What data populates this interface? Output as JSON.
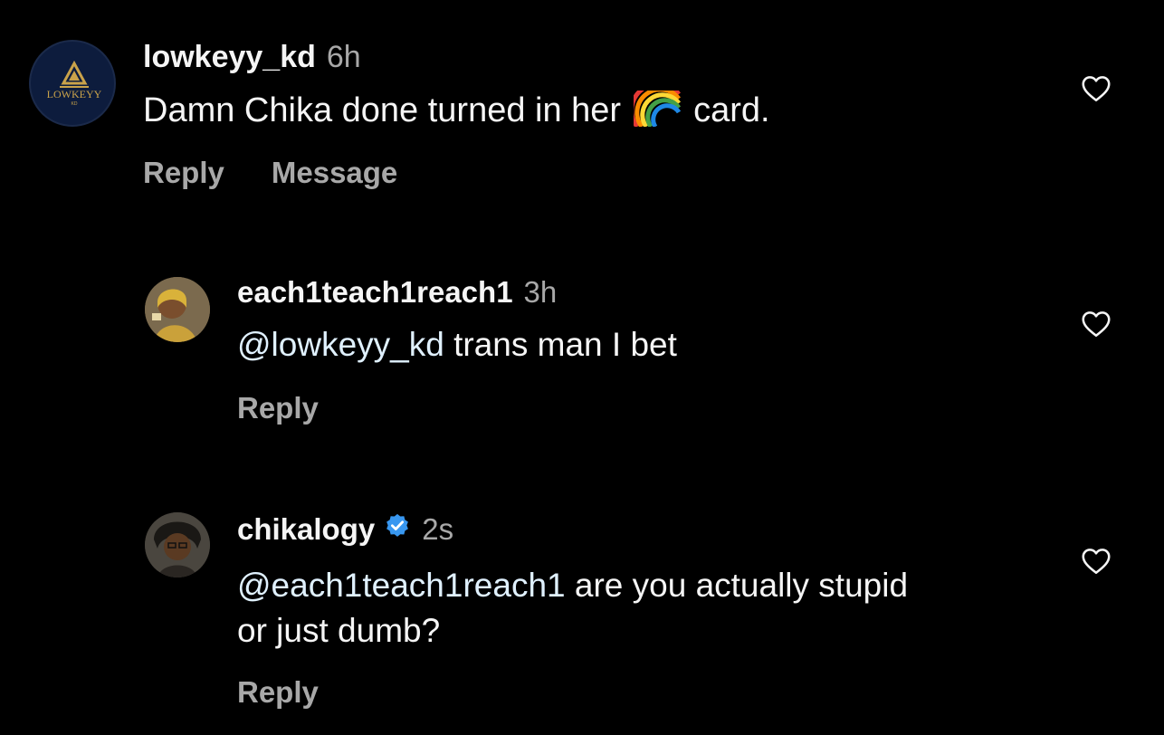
{
  "comments": [
    {
      "username": "lowkeyy_kd",
      "time": "6h",
      "text_before": "Damn Chika done turned in her",
      "emoji": "rainbow-emoji",
      "text_after": "card.",
      "actions": [
        "Reply",
        "Message"
      ],
      "avatar_text": "LOWKEYY",
      "avatar_subtext": "KD"
    },
    {
      "username": "each1teach1reach1",
      "time": "3h",
      "mention": "@lowkeyy_kd",
      "text": " trans man I bet",
      "actions": [
        "Reply"
      ]
    },
    {
      "username": "chikalogy",
      "verified": true,
      "time": "2s",
      "mention": "@each1teach1reach1",
      "text_line1": " are you actually stupid",
      "text_line2": "or just dumb?",
      "actions": [
        "Reply"
      ]
    }
  ],
  "colors": {
    "background": "#000000",
    "primary_text": "#f5f5f5",
    "secondary_text": "#a8a8a8",
    "mention": "#e0f1ff",
    "verified": "#3897f0",
    "logo_gold": "#c9a24a",
    "logo_navy": "#0d1c3d"
  },
  "icons": [
    "heart-icon",
    "verified-badge-icon",
    "rainbow-emoji"
  ]
}
